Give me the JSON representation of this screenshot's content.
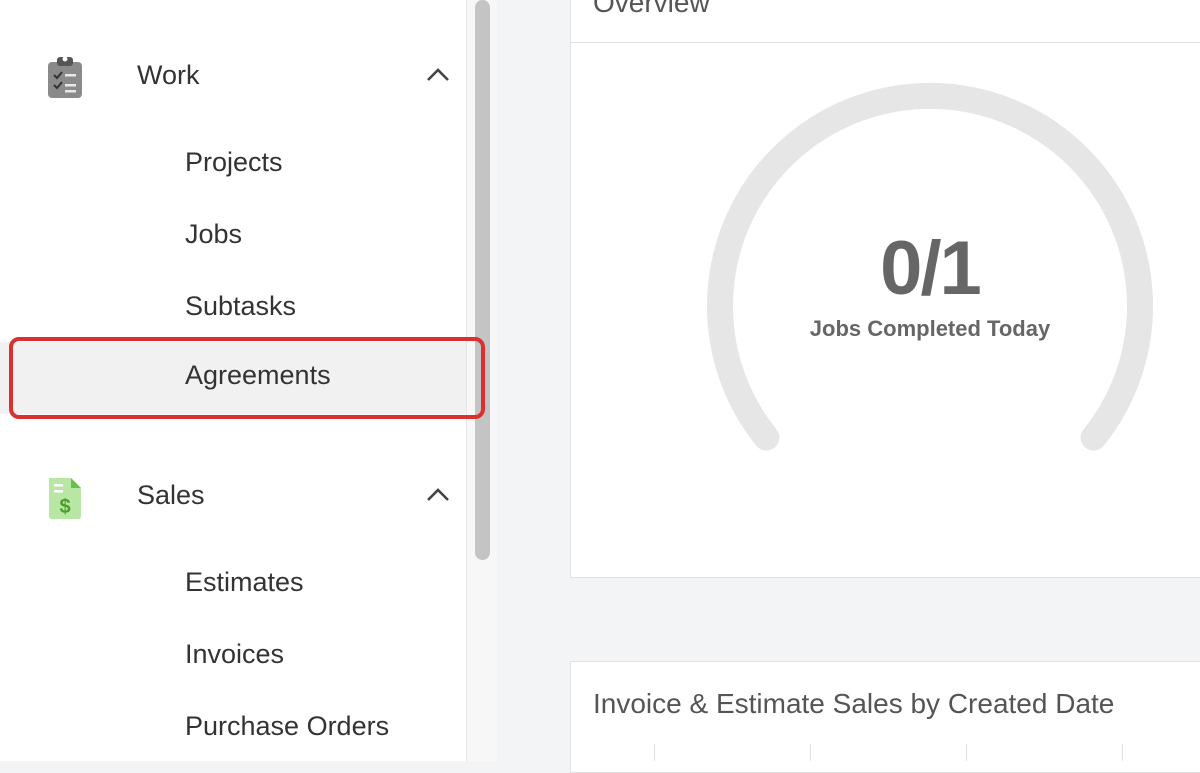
{
  "sidebar": {
    "sections": [
      {
        "label": "Work",
        "icon": "clipboard-icon",
        "items": [
          "Projects",
          "Jobs",
          "Subtasks",
          "Agreements"
        ],
        "active_item": "Agreements"
      },
      {
        "label": "Sales",
        "icon": "dollar-document-icon",
        "items": [
          "Estimates",
          "Invoices",
          "Purchase Orders"
        ]
      }
    ]
  },
  "overview": {
    "title": "Overview",
    "gauge_value": "0/1",
    "gauge_label": "Jobs Completed Today",
    "completed": 0,
    "total": 1
  },
  "sales_chart": {
    "title": "Invoice & Estimate Sales by Created Date"
  },
  "colors": {
    "highlight": "#d93030",
    "gauge_track": "#e6e6e6",
    "sales_icon": "#6cc04a",
    "work_icon": "#7a7a7a"
  }
}
